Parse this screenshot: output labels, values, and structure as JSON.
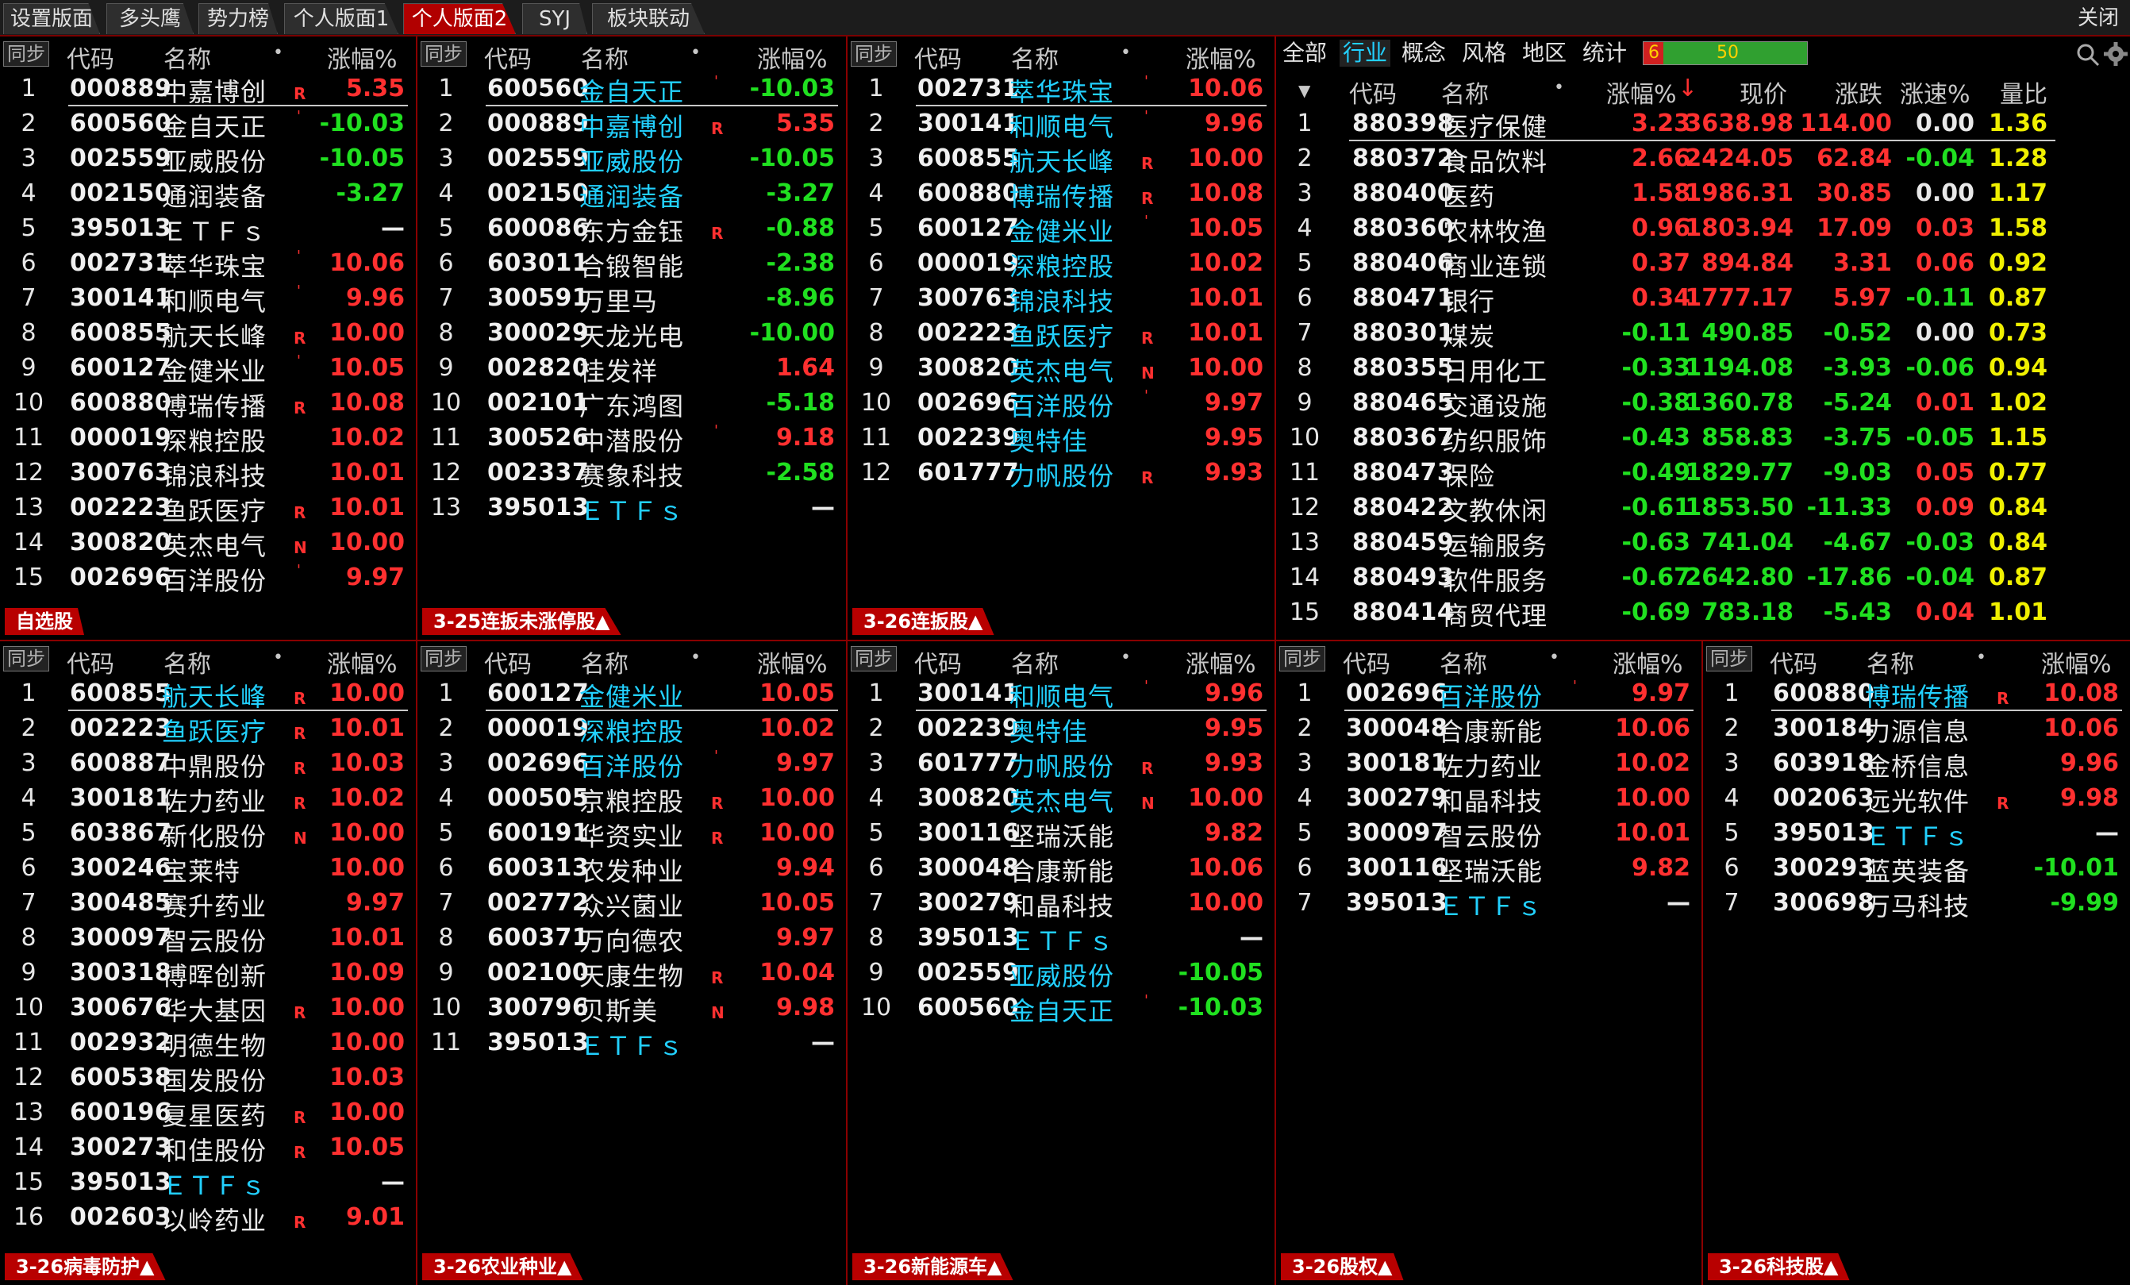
{
  "tabs": [
    {
      "label": "设置版面",
      "active": false
    },
    {
      "label": "多头鹰",
      "active": false
    },
    {
      "label": "势力榜",
      "active": false
    },
    {
      "label": "个人版面1",
      "active": false
    },
    {
      "label": "个人版面2",
      "active": true
    },
    {
      "label": "SYJ",
      "active": false
    },
    {
      "label": "板块联动",
      "active": false
    }
  ],
  "close_label": "关闭",
  "sync_label": "同步",
  "col_code": "代码",
  "col_name": "名称",
  "col_pct": "涨幅%",
  "dot_glyph": "•",
  "panels": [
    {
      "footer": "自选股",
      "rows": [
        {
          "code": "000889",
          "name": "中嘉博创",
          "mark": "R",
          "pct": "5.35",
          "dir": "up",
          "nc": "wh"
        },
        {
          "code": "600560",
          "name": "金自天正",
          "mark": "'",
          "pct": "-10.03",
          "dir": "dn",
          "nc": "wh"
        },
        {
          "code": "002559",
          "name": "亚威股份",
          "mark": "",
          "pct": "-10.05",
          "dir": "dn",
          "nc": "wh"
        },
        {
          "code": "002150",
          "name": "通润装备",
          "mark": "",
          "pct": "-3.27",
          "dir": "dn",
          "nc": "wh"
        },
        {
          "code": "395013",
          "name": "ＥＴＦｓ",
          "mark": "",
          "pct": "—",
          "dir": "wh",
          "nc": "wh"
        },
        {
          "code": "002731",
          "name": "萃华珠宝",
          "mark": "'",
          "pct": "10.06",
          "dir": "up",
          "nc": "wh"
        },
        {
          "code": "300141",
          "name": "和顺电气",
          "mark": "'",
          "pct": "9.96",
          "dir": "up",
          "nc": "wh"
        },
        {
          "code": "600855",
          "name": "航天长峰",
          "mark": "R",
          "pct": "10.00",
          "dir": "up",
          "nc": "wh"
        },
        {
          "code": "600127",
          "name": "金健米业",
          "mark": "'",
          "pct": "10.05",
          "dir": "up",
          "nc": "wh"
        },
        {
          "code": "600880",
          "name": "博瑞传播",
          "mark": "R",
          "pct": "10.08",
          "dir": "up",
          "nc": "wh"
        },
        {
          "code": "000019",
          "name": "深粮控股",
          "mark": "",
          "pct": "10.02",
          "dir": "up",
          "nc": "wh"
        },
        {
          "code": "300763",
          "name": "锦浪科技",
          "mark": "",
          "pct": "10.01",
          "dir": "up",
          "nc": "wh"
        },
        {
          "code": "002223",
          "name": "鱼跃医疗",
          "mark": "R",
          "pct": "10.01",
          "dir": "up",
          "nc": "wh"
        },
        {
          "code": "300820",
          "name": "英杰电气",
          "mark": "N",
          "pct": "10.00",
          "dir": "up",
          "nc": "wh"
        },
        {
          "code": "002696",
          "name": "百洋股份",
          "mark": "'",
          "pct": "9.97",
          "dir": "up",
          "nc": "wh"
        }
      ]
    },
    {
      "footer": "3-25连扳未涨停股▲",
      "rows": [
        {
          "code": "600560",
          "name": "金自天正",
          "mark": "'",
          "pct": "-10.03",
          "dir": "dn",
          "nc": "cy"
        },
        {
          "code": "000889",
          "name": "中嘉博创",
          "mark": "R",
          "pct": "5.35",
          "dir": "up",
          "nc": "cy"
        },
        {
          "code": "002559",
          "name": "亚威股份",
          "mark": "",
          "pct": "-10.05",
          "dir": "dn",
          "nc": "cy"
        },
        {
          "code": "002150",
          "name": "通润装备",
          "mark": "",
          "pct": "-3.27",
          "dir": "dn",
          "nc": "cy"
        },
        {
          "code": "600086",
          "name": "东方金钰",
          "mark": "R",
          "pct": "-0.88",
          "dir": "dn",
          "nc": "wh"
        },
        {
          "code": "603011",
          "name": "合锻智能",
          "mark": "",
          "pct": "-2.38",
          "dir": "dn",
          "nc": "wh"
        },
        {
          "code": "300591",
          "name": "万里马",
          "mark": "",
          "pct": "-8.96",
          "dir": "dn",
          "nc": "wh"
        },
        {
          "code": "300029",
          "name": "天龙光电",
          "mark": "",
          "pct": "-10.00",
          "dir": "dn",
          "nc": "wh"
        },
        {
          "code": "002820",
          "name": "桂发祥",
          "mark": "",
          "pct": "1.64",
          "dir": "up",
          "nc": "wh"
        },
        {
          "code": "002101",
          "name": "广东鸿图",
          "mark": "",
          "pct": "-5.18",
          "dir": "dn",
          "nc": "wh"
        },
        {
          "code": "300526",
          "name": "中潜股份",
          "mark": "'",
          "pct": "9.18",
          "dir": "up",
          "nc": "wh"
        },
        {
          "code": "002337",
          "name": "赛象科技",
          "mark": "",
          "pct": "-2.58",
          "dir": "dn",
          "nc": "wh"
        },
        {
          "code": "395013",
          "name": "ＥＴＦｓ",
          "mark": "",
          "pct": "—",
          "dir": "wh",
          "nc": "cy"
        }
      ]
    },
    {
      "footer": "3-26连扳股▲",
      "rows": [
        {
          "code": "002731",
          "name": "萃华珠宝",
          "mark": "'",
          "pct": "10.06",
          "dir": "up",
          "nc": "cy"
        },
        {
          "code": "300141",
          "name": "和顺电气",
          "mark": "'",
          "pct": "9.96",
          "dir": "up",
          "nc": "cy"
        },
        {
          "code": "600855",
          "name": "航天长峰",
          "mark": "R",
          "pct": "10.00",
          "dir": "up",
          "nc": "cy"
        },
        {
          "code": "600880",
          "name": "博瑞传播",
          "mark": "R",
          "pct": "10.08",
          "dir": "up",
          "nc": "cy"
        },
        {
          "code": "600127",
          "name": "金健米业",
          "mark": "'",
          "pct": "10.05",
          "dir": "up",
          "nc": "cy"
        },
        {
          "code": "000019",
          "name": "深粮控股",
          "mark": "",
          "pct": "10.02",
          "dir": "up",
          "nc": "cy"
        },
        {
          "code": "300763",
          "name": "锦浪科技",
          "mark": "",
          "pct": "10.01",
          "dir": "up",
          "nc": "cy"
        },
        {
          "code": "002223",
          "name": "鱼跃医疗",
          "mark": "R",
          "pct": "10.01",
          "dir": "up",
          "nc": "cy"
        },
        {
          "code": "300820",
          "name": "英杰电气",
          "mark": "N",
          "pct": "10.00",
          "dir": "up",
          "nc": "cy"
        },
        {
          "code": "002696",
          "name": "百洋股份",
          "mark": "'",
          "pct": "9.97",
          "dir": "up",
          "nc": "cy"
        },
        {
          "code": "002239",
          "name": "奥特佳",
          "mark": "",
          "pct": "9.95",
          "dir": "up",
          "nc": "cy"
        },
        {
          "code": "601777",
          "name": "力帆股份",
          "mark": "R",
          "pct": "9.93",
          "dir": "up",
          "nc": "cy"
        }
      ]
    },
    {
      "footer": "3-26病毒防护▲",
      "rows": [
        {
          "code": "600855",
          "name": "航天长峰",
          "mark": "R",
          "pct": "10.00",
          "dir": "up",
          "nc": "cy"
        },
        {
          "code": "002223",
          "name": "鱼跃医疗",
          "mark": "R",
          "pct": "10.01",
          "dir": "up",
          "nc": "cy"
        },
        {
          "code": "600887",
          "name": "中鼎股份",
          "mark": "R",
          "pct": "10.03",
          "dir": "up",
          "nc": "wh"
        },
        {
          "code": "300181",
          "name": "佐力药业",
          "mark": "R",
          "pct": "10.02",
          "dir": "up",
          "nc": "wh"
        },
        {
          "code": "603867",
          "name": "新化股份",
          "mark": "N",
          "pct": "10.00",
          "dir": "up",
          "nc": "wh"
        },
        {
          "code": "300246",
          "name": "宝莱特",
          "mark": "",
          "pct": "10.00",
          "dir": "up",
          "nc": "wh"
        },
        {
          "code": "300485",
          "name": "赛升药业",
          "mark": "",
          "pct": "9.97",
          "dir": "up",
          "nc": "wh"
        },
        {
          "code": "300097",
          "name": "智云股份",
          "mark": "",
          "pct": "10.01",
          "dir": "up",
          "nc": "wh"
        },
        {
          "code": "300318",
          "name": "博晖创新",
          "mark": "",
          "pct": "10.09",
          "dir": "up",
          "nc": "wh"
        },
        {
          "code": "300676",
          "name": "华大基因",
          "mark": "R",
          "pct": "10.00",
          "dir": "up",
          "nc": "wh"
        },
        {
          "code": "002932",
          "name": "明德生物",
          "mark": "",
          "pct": "10.00",
          "dir": "up",
          "nc": "wh"
        },
        {
          "code": "600538",
          "name": "国发股份",
          "mark": "",
          "pct": "10.03",
          "dir": "up",
          "nc": "wh"
        },
        {
          "code": "600196",
          "name": "复星医药",
          "mark": "R",
          "pct": "10.00",
          "dir": "up",
          "nc": "wh"
        },
        {
          "code": "300273",
          "name": "和佳股份",
          "mark": "R",
          "pct": "10.05",
          "dir": "up",
          "nc": "wh"
        },
        {
          "code": "395013",
          "name": "ＥＴＦｓ",
          "mark": "",
          "pct": "—",
          "dir": "wh",
          "nc": "cy"
        },
        {
          "code": "002603",
          "name": "以岭药业",
          "mark": "R",
          "pct": "9.01",
          "dir": "up",
          "nc": "wh"
        }
      ]
    },
    {
      "footer": "3-26农业种业▲",
      "rows": [
        {
          "code": "600127",
          "name": "金健米业",
          "mark": "",
          "pct": "10.05",
          "dir": "up",
          "nc": "cy"
        },
        {
          "code": "000019",
          "name": "深粮控股",
          "mark": "",
          "pct": "10.02",
          "dir": "up",
          "nc": "cy"
        },
        {
          "code": "002696",
          "name": "百洋股份",
          "mark": "'",
          "pct": "9.97",
          "dir": "up",
          "nc": "cy"
        },
        {
          "code": "000505",
          "name": "京粮控股",
          "mark": "R",
          "pct": "10.00",
          "dir": "up",
          "nc": "wh"
        },
        {
          "code": "600191",
          "name": "华资实业",
          "mark": "R",
          "pct": "10.00",
          "dir": "up",
          "nc": "wh"
        },
        {
          "code": "600313",
          "name": "农发种业",
          "mark": "",
          "pct": "9.94",
          "dir": "up",
          "nc": "wh"
        },
        {
          "code": "002772",
          "name": "众兴菌业",
          "mark": "",
          "pct": "10.05",
          "dir": "up",
          "nc": "wh"
        },
        {
          "code": "600371",
          "name": "万向德农",
          "mark": "",
          "pct": "9.97",
          "dir": "up",
          "nc": "wh"
        },
        {
          "code": "002100",
          "name": "天康生物",
          "mark": "R",
          "pct": "10.04",
          "dir": "up",
          "nc": "wh"
        },
        {
          "code": "300796",
          "name": "贝斯美",
          "mark": "N",
          "pct": "9.98",
          "dir": "up",
          "nc": "wh"
        },
        {
          "code": "395013",
          "name": "ＥＴＦｓ",
          "mark": "",
          "pct": "—",
          "dir": "wh",
          "nc": "cy"
        }
      ]
    },
    {
      "footer": "3-26新能源车▲",
      "rows": [
        {
          "code": "300141",
          "name": "和顺电气",
          "mark": "'",
          "pct": "9.96",
          "dir": "up",
          "nc": "cy"
        },
        {
          "code": "002239",
          "name": "奥特佳",
          "mark": "",
          "pct": "9.95",
          "dir": "up",
          "nc": "cy"
        },
        {
          "code": "601777",
          "name": "力帆股份",
          "mark": "R",
          "pct": "9.93",
          "dir": "up",
          "nc": "cy"
        },
        {
          "code": "300820",
          "name": "英杰电气",
          "mark": "N",
          "pct": "10.00",
          "dir": "up",
          "nc": "cy"
        },
        {
          "code": "300116",
          "name": "坚瑞沃能",
          "mark": "",
          "pct": "9.82",
          "dir": "up",
          "nc": "wh"
        },
        {
          "code": "300048",
          "name": "合康新能",
          "mark": "",
          "pct": "10.06",
          "dir": "up",
          "nc": "wh"
        },
        {
          "code": "300279",
          "name": "和晶科技",
          "mark": "",
          "pct": "10.00",
          "dir": "up",
          "nc": "wh"
        },
        {
          "code": "395013",
          "name": "ＥＴＦｓ",
          "mark": "",
          "pct": "—",
          "dir": "wh",
          "nc": "cy"
        },
        {
          "code": "002559",
          "name": "亚威股份",
          "mark": "",
          "pct": "-10.05",
          "dir": "dn",
          "nc": "cy"
        },
        {
          "code": "600560",
          "name": "金自天正",
          "mark": "'",
          "pct": "-10.03",
          "dir": "dn",
          "nc": "cy"
        }
      ]
    },
    {
      "footer": "3-26股权▲",
      "rows": [
        {
          "code": "002696",
          "name": "百洋股份",
          "mark": "'",
          "pct": "9.97",
          "dir": "up",
          "nc": "cy"
        },
        {
          "code": "300048",
          "name": "合康新能",
          "mark": "",
          "pct": "10.06",
          "dir": "up",
          "nc": "wh"
        },
        {
          "code": "300181",
          "name": "佐力药业",
          "mark": "",
          "pct": "10.02",
          "dir": "up",
          "nc": "wh"
        },
        {
          "code": "300279",
          "name": "和晶科技",
          "mark": "",
          "pct": "10.00",
          "dir": "up",
          "nc": "wh"
        },
        {
          "code": "300097",
          "name": "智云股份",
          "mark": "",
          "pct": "10.01",
          "dir": "up",
          "nc": "wh"
        },
        {
          "code": "300116",
          "name": "坚瑞沃能",
          "mark": "",
          "pct": "9.82",
          "dir": "up",
          "nc": "wh"
        },
        {
          "code": "395013",
          "name": "ＥＴＦｓ",
          "mark": "",
          "pct": "—",
          "dir": "wh",
          "nc": "cy"
        }
      ]
    },
    {
      "footer": "3-26科技股▲",
      "rows": [
        {
          "code": "600880",
          "name": "博瑞传播",
          "mark": "R",
          "pct": "10.08",
          "dir": "up",
          "nc": "cy"
        },
        {
          "code": "300184",
          "name": "力源信息",
          "mark": "",
          "pct": "10.06",
          "dir": "up",
          "nc": "wh"
        },
        {
          "code": "603918",
          "name": "金桥信息",
          "mark": "",
          "pct": "9.96",
          "dir": "up",
          "nc": "wh"
        },
        {
          "code": "002063",
          "name": "远光软件",
          "mark": "R",
          "pct": "9.98",
          "dir": "up",
          "nc": "wh"
        },
        {
          "code": "395013",
          "name": "ＥＴＦｓ",
          "mark": "",
          "pct": "—",
          "dir": "wh",
          "nc": "cy"
        },
        {
          "code": "300293",
          "name": "蓝英装备",
          "mark": "",
          "pct": "-10.01",
          "dir": "dn",
          "nc": "wh"
        },
        {
          "code": "300698",
          "name": "万马科技",
          "mark": "",
          "pct": "-9.99",
          "dir": "dn",
          "nc": "wh"
        }
      ]
    }
  ],
  "sector": {
    "filter_tabs": [
      "全部",
      "行业",
      "概念",
      "风格",
      "地区",
      "统计"
    ],
    "active_filter": "行业",
    "progress_left": "6",
    "progress_right": "50",
    "progress_fraction": 0.12,
    "headers": {
      "code": "代码",
      "name": "名称",
      "pct": "涨幅%",
      "price": "现价",
      "change": "涨跌",
      "speed": "涨速%",
      "vol": "量比"
    },
    "sort_arrow": "↓",
    "rows": [
      {
        "code": "880398",
        "name": "医疗保健",
        "pct": "3.23",
        "price": "3638.98",
        "change": "114.00",
        "speed": "0.00",
        "vol": "1.36"
      },
      {
        "code": "880372",
        "name": "食品饮料",
        "pct": "2.66",
        "price": "2424.05",
        "change": "62.84",
        "speed": "-0.04",
        "vol": "1.28"
      },
      {
        "code": "880400",
        "name": "医药",
        "pct": "1.58",
        "price": "1986.31",
        "change": "30.85",
        "speed": "0.00",
        "vol": "1.17"
      },
      {
        "code": "880360",
        "name": "农林牧渔",
        "pct": "0.96",
        "price": "1803.94",
        "change": "17.09",
        "speed": "0.03",
        "vol": "1.58"
      },
      {
        "code": "880406",
        "name": "商业连锁",
        "pct": "0.37",
        "price": "894.84",
        "change": "3.31",
        "speed": "0.06",
        "vol": "0.92"
      },
      {
        "code": "880471",
        "name": "银行",
        "pct": "0.34",
        "price": "1777.17",
        "change": "5.97",
        "speed": "-0.11",
        "vol": "0.87"
      },
      {
        "code": "880301",
        "name": "煤炭",
        "pct": "-0.11",
        "price": "490.85",
        "change": "-0.52",
        "speed": "0.00",
        "vol": "0.73"
      },
      {
        "code": "880355",
        "name": "日用化工",
        "pct": "-0.33",
        "price": "1194.08",
        "change": "-3.93",
        "speed": "-0.06",
        "vol": "0.94"
      },
      {
        "code": "880465",
        "name": "交通设施",
        "pct": "-0.38",
        "price": "1360.78",
        "change": "-5.24",
        "speed": "0.01",
        "vol": "1.02"
      },
      {
        "code": "880367",
        "name": "纺织服饰",
        "pct": "-0.43",
        "price": "858.83",
        "change": "-3.75",
        "speed": "-0.05",
        "vol": "1.15"
      },
      {
        "code": "880473",
        "name": "保险",
        "pct": "-0.49",
        "price": "1829.77",
        "change": "-9.03",
        "speed": "0.05",
        "vol": "0.77"
      },
      {
        "code": "880422",
        "name": "文教休闲",
        "pct": "-0.61",
        "price": "1853.50",
        "change": "-11.33",
        "speed": "0.09",
        "vol": "0.84"
      },
      {
        "code": "880459",
        "name": "运输服务",
        "pct": "-0.63",
        "price": "741.04",
        "change": "-4.67",
        "speed": "-0.03",
        "vol": "0.84"
      },
      {
        "code": "880493",
        "name": "软件服务",
        "pct": "-0.67",
        "price": "2642.80",
        "change": "-17.86",
        "speed": "-0.04",
        "vol": "0.87"
      },
      {
        "code": "880414",
        "name": "商贸代理",
        "pct": "-0.69",
        "price": "783.18",
        "change": "-5.43",
        "speed": "0.04",
        "vol": "1.01"
      }
    ]
  }
}
